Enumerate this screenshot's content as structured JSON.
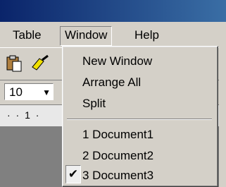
{
  "menubar": {
    "items": [
      "Table",
      "Window",
      "Help"
    ]
  },
  "toolbar": {
    "font_size": "10"
  },
  "ruler": {
    "marks": "· · 1 ·"
  },
  "window_menu": {
    "items": [
      {
        "label": "New Window"
      },
      {
        "label": "Arrange All"
      },
      {
        "label": "Split"
      },
      {
        "label": "1 Document1"
      },
      {
        "label": "2 Document2"
      },
      {
        "label": "3 Document3",
        "checked": true
      }
    ],
    "checkmark": "✔"
  }
}
